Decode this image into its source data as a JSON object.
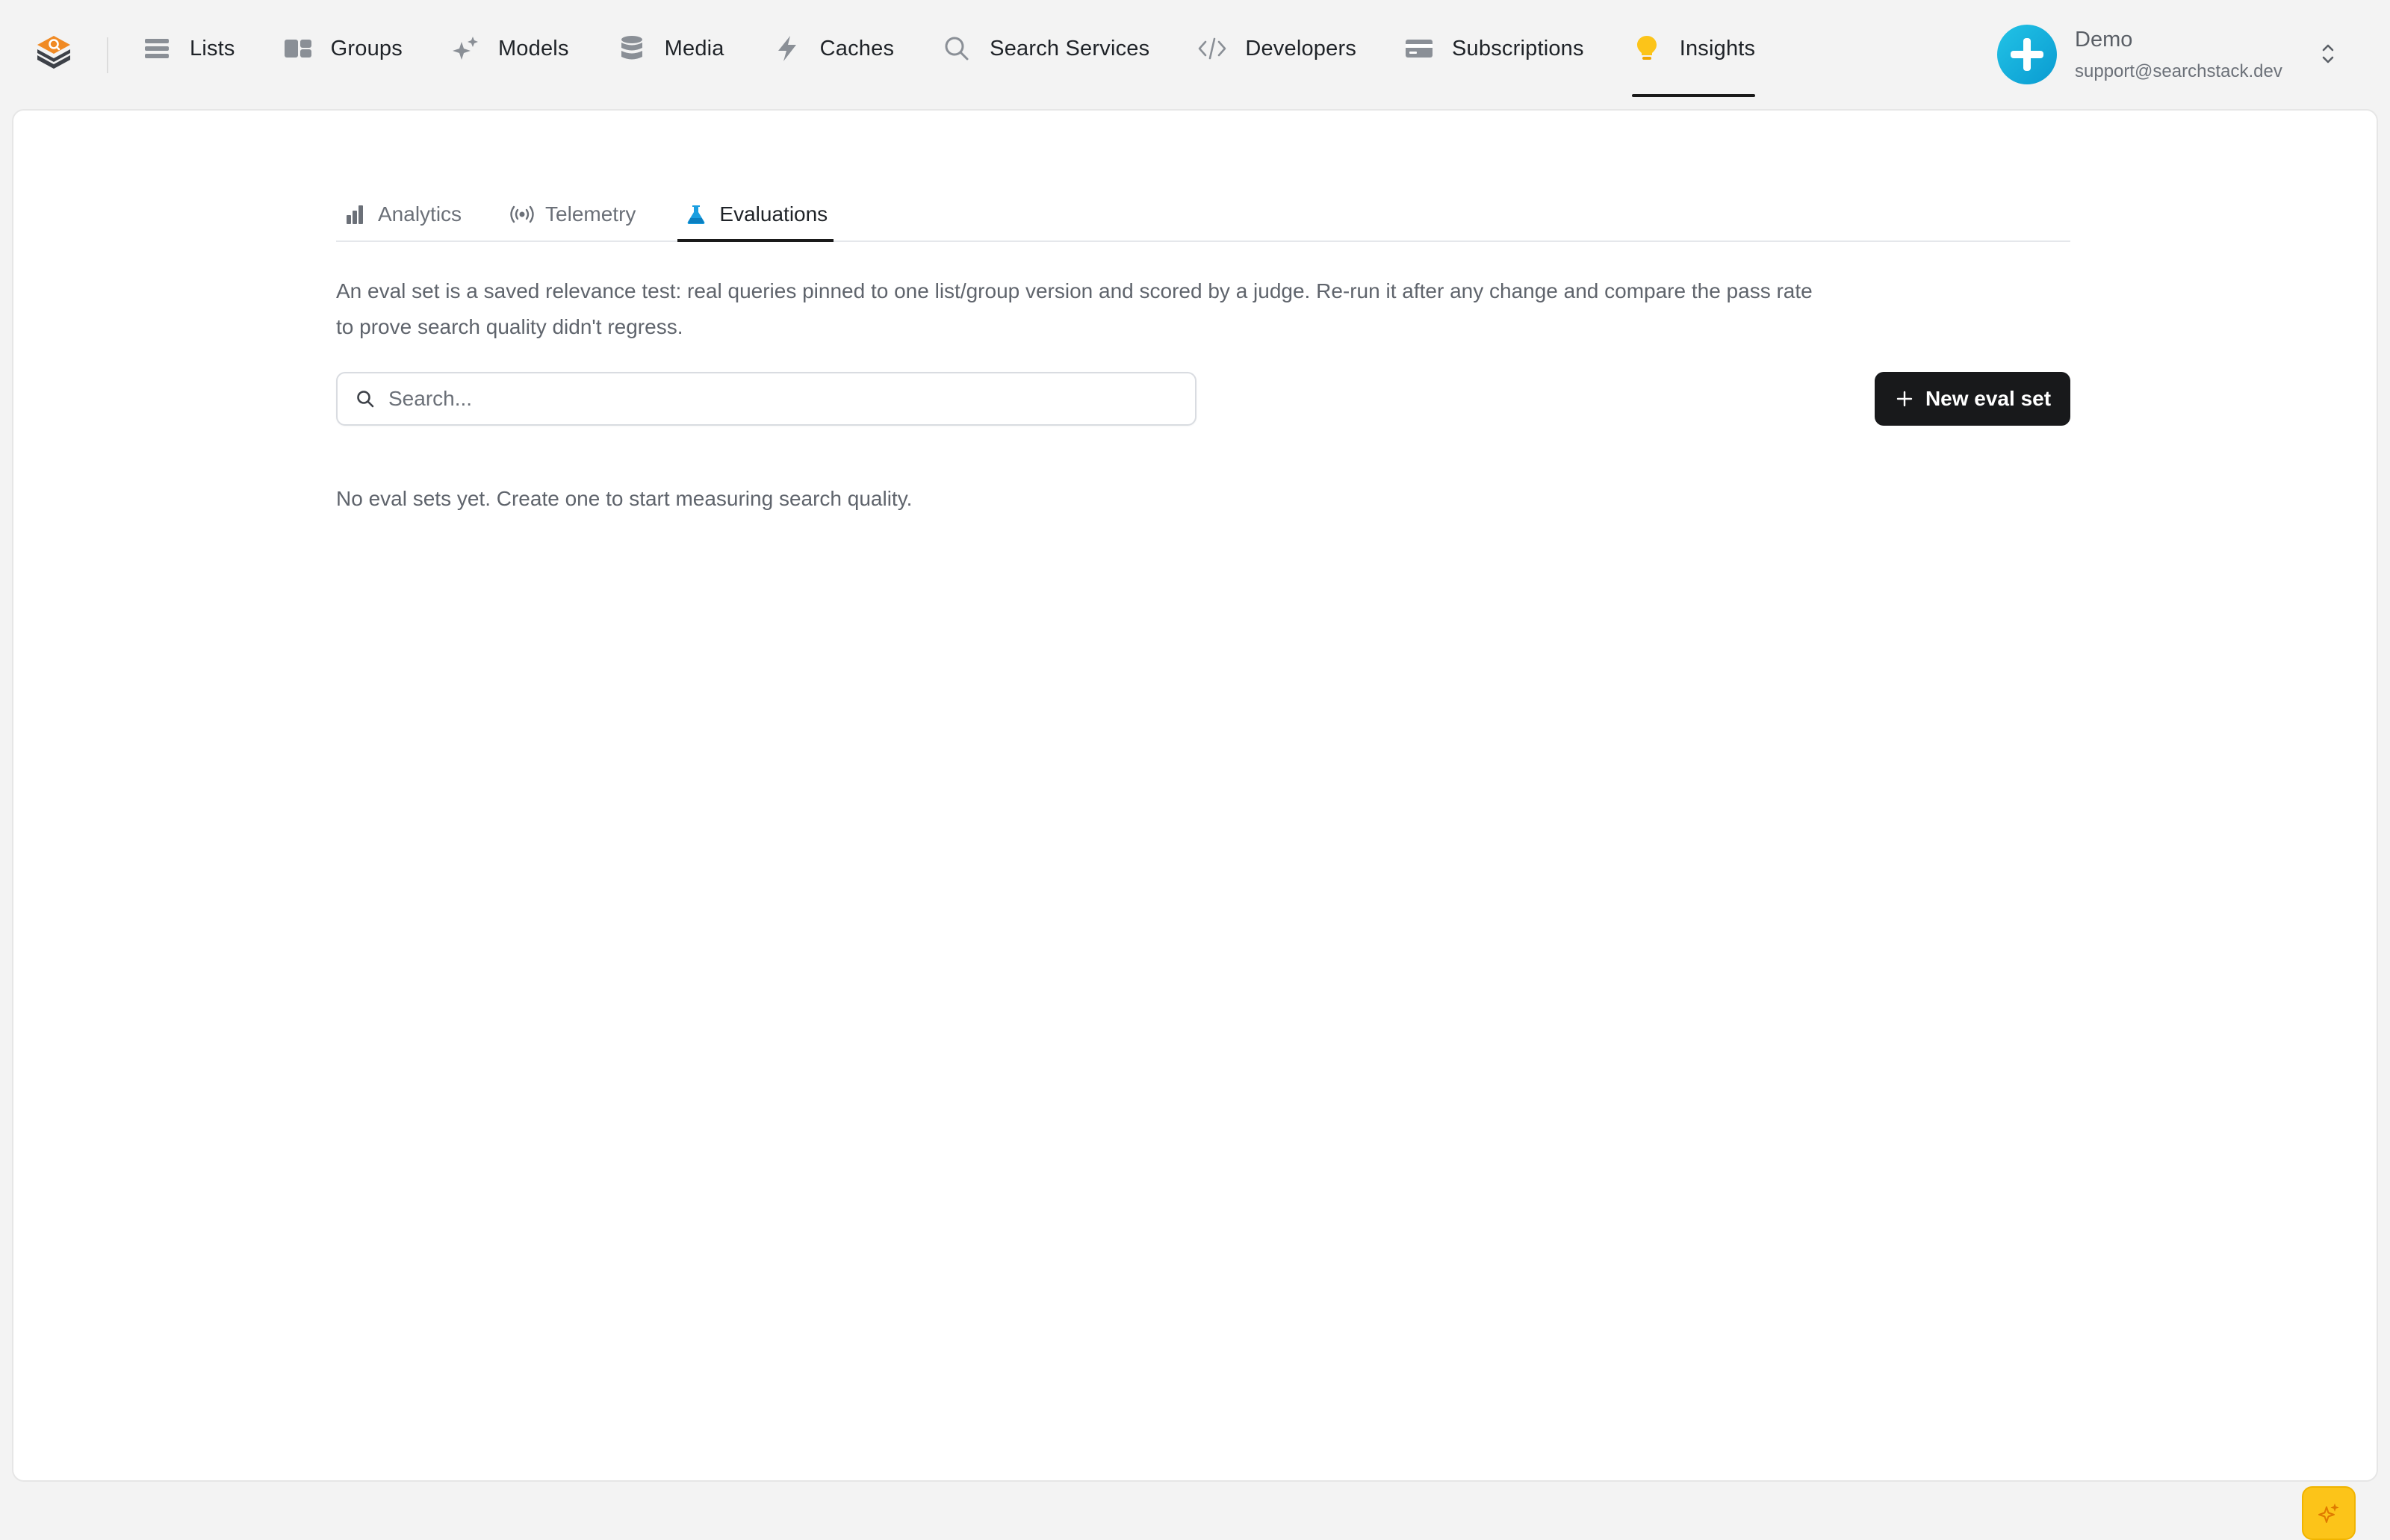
{
  "nav": {
    "items": [
      {
        "id": "lists",
        "label": "Lists",
        "icon": "list-icon"
      },
      {
        "id": "groups",
        "label": "Groups",
        "icon": "groups-icon"
      },
      {
        "id": "models",
        "label": "Models",
        "icon": "sparkles-icon"
      },
      {
        "id": "media",
        "label": "Media",
        "icon": "database-icon"
      },
      {
        "id": "caches",
        "label": "Caches",
        "icon": "bolt-icon"
      },
      {
        "id": "search-services",
        "label": "Search Services",
        "icon": "search-icon"
      },
      {
        "id": "developers",
        "label": "Developers",
        "icon": "code-icon"
      },
      {
        "id": "subscriptions",
        "label": "Subscriptions",
        "icon": "credit-card-icon"
      },
      {
        "id": "insights",
        "label": "Insights",
        "icon": "lightbulb-icon",
        "active": true
      }
    ]
  },
  "account": {
    "name": "Demo",
    "email": "support@searchstack.dev"
  },
  "tabs": [
    {
      "id": "analytics",
      "label": "Analytics",
      "icon": "bar-chart-icon"
    },
    {
      "id": "telemetry",
      "label": "Telemetry",
      "icon": "broadcast-icon"
    },
    {
      "id": "evaluations",
      "label": "Evaluations",
      "icon": "flask-icon",
      "active": true
    }
  ],
  "evaluations": {
    "description": "An eval set is a saved relevance test: real queries pinned to one list/group version and scored by a judge. Re-run it after any change and compare the pass rate to prove search quality didn't regress.",
    "search_placeholder": "Search...",
    "new_button_label": "New eval set",
    "empty_message": "No eval sets yet. Create one to start measuring search quality."
  },
  "colors": {
    "accent_dark": "#18191b",
    "avatar": "#13b1dd",
    "insights_bulb": "#fcc419",
    "logo_orange": "#f08a24",
    "flask_blue": "#1a9ee0"
  }
}
